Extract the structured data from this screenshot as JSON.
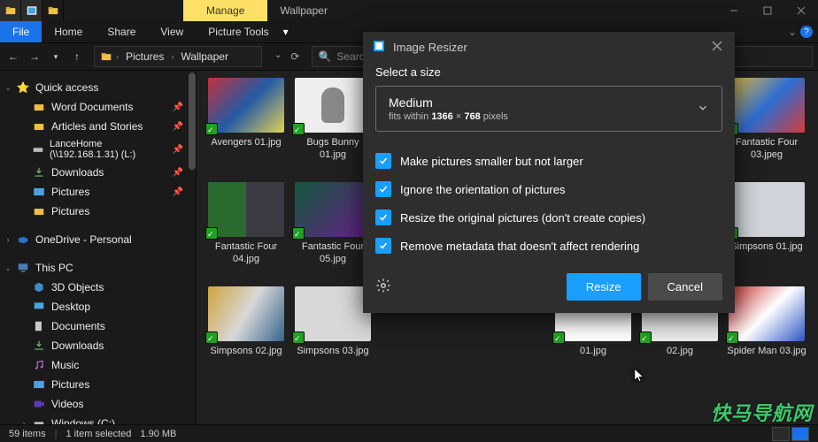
{
  "window": {
    "ribbon_context_tab": "Manage",
    "title": "Wallpaper"
  },
  "ribbon": {
    "file": "File",
    "tabs": [
      "Home",
      "Share",
      "View",
      "Picture Tools"
    ]
  },
  "address": {
    "segments": [
      "Pictures",
      "Wallpaper"
    ],
    "search_placeholder": "Search Wallpaper"
  },
  "sidebar": {
    "quick_access": "Quick access",
    "quick_items": [
      "Word Documents",
      "Articles and Stories",
      "LanceHome (\\\\192.168.1.31) (L:)",
      "Downloads",
      "Pictures",
      "Pictures"
    ],
    "onedrive": "OneDrive - Personal",
    "this_pc": "This PC",
    "pc_items": [
      "3D Objects",
      "Desktop",
      "Documents",
      "Downloads",
      "Music",
      "Pictures",
      "Videos",
      "Windows (C:)"
    ]
  },
  "files": {
    "row1": [
      "Avengers 01.jpg",
      "Bugs Bunny 01.jpg",
      "",
      "",
      "",
      "",
      "Fantastic Four 03.jpeg"
    ],
    "row2": [
      "Fantastic Four 04.jpg",
      "Fantastic Four 05.jpg",
      "",
      "",
      "",
      "",
      "Simpsons 01.jpg"
    ],
    "row3": [
      "Simpsons 02.jpg",
      "Simpsons 03.jpg",
      "",
      "",
      "01.jpg",
      "02.jpg",
      "Spider Man 03.jpg"
    ]
  },
  "dialog": {
    "title": "Image Resizer",
    "section": "Select a size",
    "size_name": "Medium",
    "size_prefix": "fits within",
    "size_w": "1366",
    "size_x": "×",
    "size_h": "768",
    "size_unit": "pixels",
    "options": [
      "Make pictures smaller but not larger",
      "Ignore the orientation of pictures",
      "Resize the original pictures (don't create copies)",
      "Remove metadata that doesn't affect rendering"
    ],
    "resize": "Resize",
    "cancel": "Cancel"
  },
  "status": {
    "count": "59 items",
    "selection": "1 item selected",
    "size": "1.90 MB"
  },
  "watermark": "快马导航网"
}
